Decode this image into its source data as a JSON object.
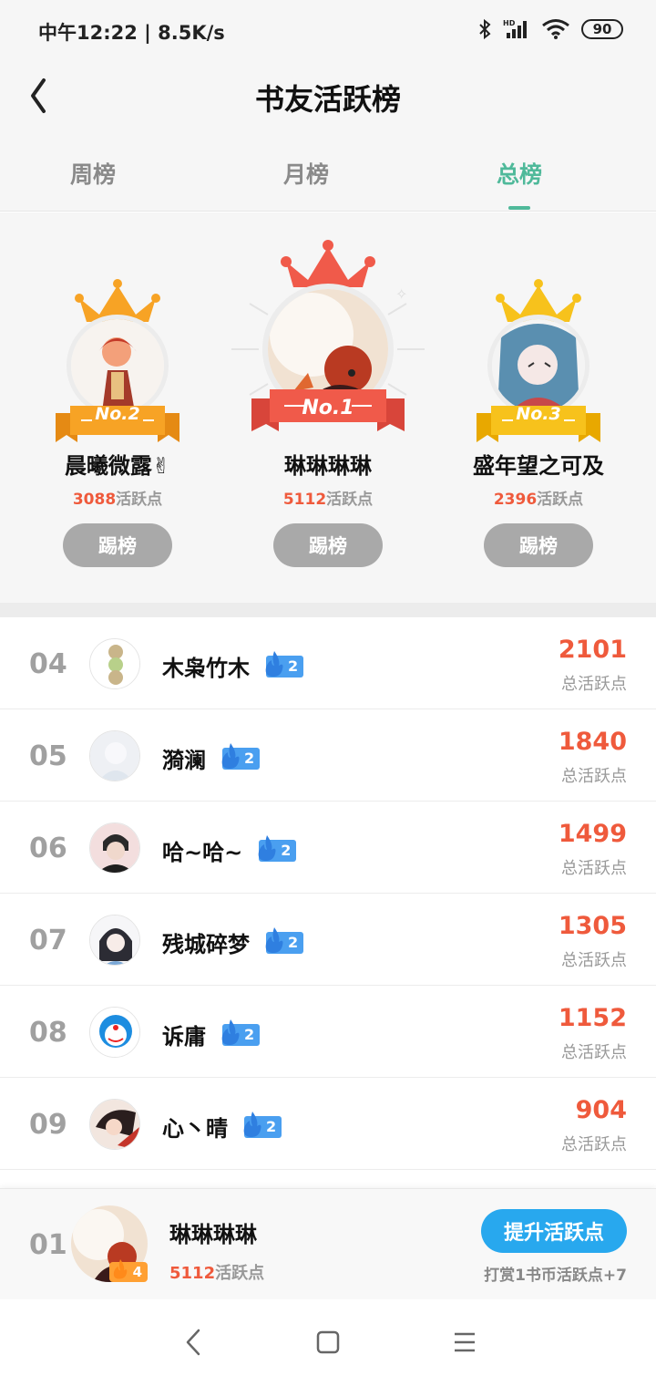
{
  "status_bar": {
    "time_speed": "中午12:22 | 8.5K/s",
    "battery": "90"
  },
  "header": {
    "title": "书友活跃榜"
  },
  "tabs": [
    {
      "label": "周榜",
      "active": false
    },
    {
      "label": "月榜",
      "active": false
    },
    {
      "label": "总榜",
      "active": true
    }
  ],
  "podium": {
    "points_suffix": "活跃点",
    "kick_label": "踢榜",
    "first": {
      "rank_label": "No.1",
      "name": "琳琳琳琳",
      "points": "5112"
    },
    "second": {
      "rank_label": "No.2",
      "name": "晨曦微露✌",
      "points": "3088"
    },
    "third": {
      "rank_label": "No.3",
      "name": "盛年望之可及",
      "points": "2396"
    }
  },
  "list": {
    "score_label": "总活跃点",
    "rows": [
      {
        "rank": "04",
        "name": "木枭竹木",
        "level": "2",
        "score": "2101"
      },
      {
        "rank": "05",
        "name": "漪澜",
        "level": "2",
        "score": "1840"
      },
      {
        "rank": "06",
        "name": "哈~哈~",
        "level": "2",
        "score": "1499"
      },
      {
        "rank": "07",
        "name": "残城碎梦",
        "level": "2",
        "score": "1305"
      },
      {
        "rank": "08",
        "name": "诉庸",
        "level": "2",
        "score": "1152"
      },
      {
        "rank": "09",
        "name": "心丶晴",
        "level": "2",
        "score": "904"
      }
    ]
  },
  "my_rank": {
    "rank": "01",
    "name": "琳琳琳琳",
    "level": "4",
    "points": "5112",
    "points_suffix": "活跃点",
    "boost_label": "提升活跃点",
    "tip": "打赏1书币活跃点+7"
  },
  "colors": {
    "accent": "#4fb99a",
    "score": "#ef5a3c",
    "boost": "#28a8ee",
    "badge": "#4a9ff0"
  }
}
